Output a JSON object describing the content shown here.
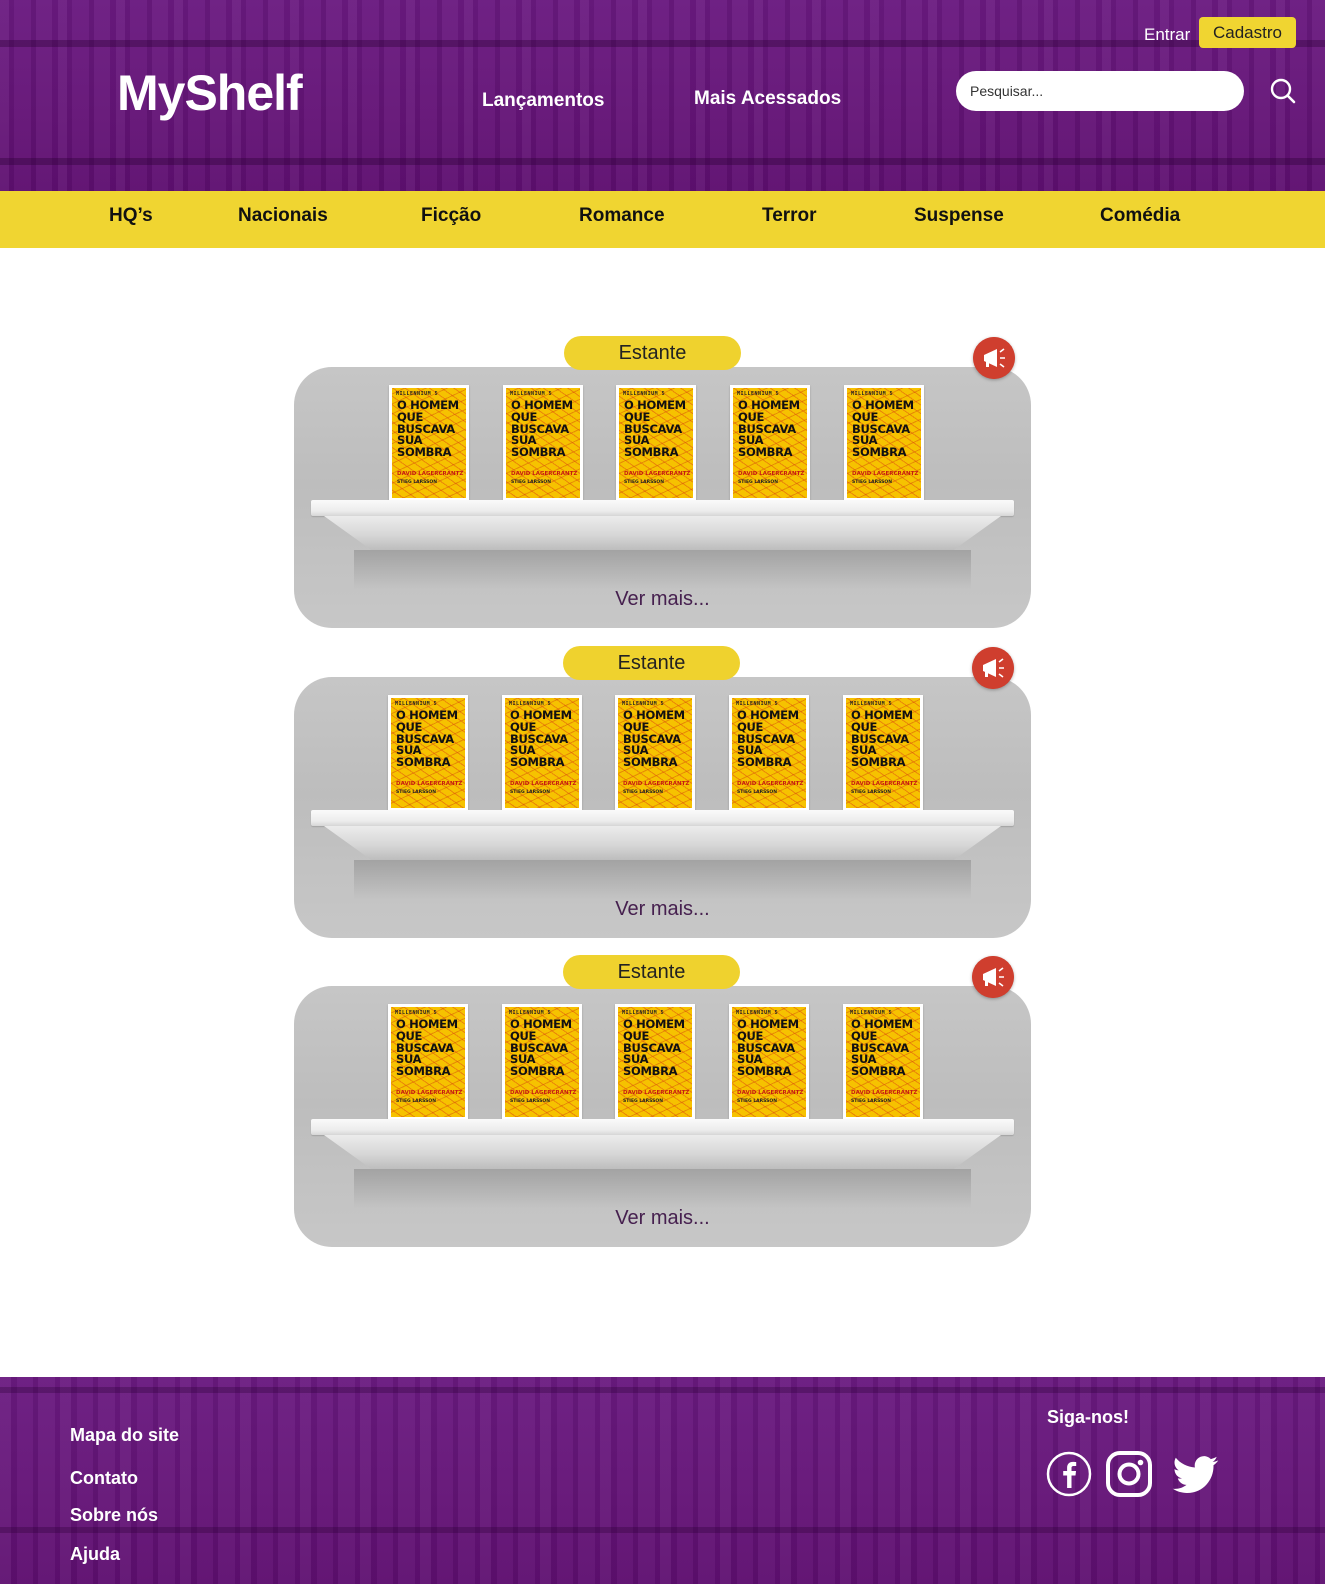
{
  "header": {
    "logo": "MyShelf",
    "nav": [
      "Lançamentos",
      "Mais Acessados"
    ],
    "login": "Entrar",
    "signup": "Cadastro",
    "search_placeholder": "Pesquisar...",
    "search_icon": "search-icon"
  },
  "categories": [
    "HQ’s",
    "Nacionais",
    "Ficção",
    "Romance",
    "Terror",
    "Suspense",
    "Comédia"
  ],
  "shelves": [
    {
      "label": "Estante",
      "see_more": "Ver mais...",
      "promo_icon": "megaphone-icon",
      "books": [
        {
          "series": "MILLENNIUM 5",
          "title": "O HOMEM QUE BUSCAVA SUA SOMBRA",
          "author": "DAVID LAGERCRANTZ",
          "creator": "STIEG LARSSON"
        },
        {
          "series": "MILLENNIUM 5",
          "title": "O HOMEM QUE BUSCAVA SUA SOMBRA",
          "author": "DAVID LAGERCRANTZ",
          "creator": "STIEG LARSSON"
        },
        {
          "series": "MILLENNIUM 5",
          "title": "O HOMEM QUE BUSCAVA SUA SOMBRA",
          "author": "DAVID LAGERCRANTZ",
          "creator": "STIEG LARSSON"
        },
        {
          "series": "MILLENNIUM 5",
          "title": "O HOMEM QUE BUSCAVA SUA SOMBRA",
          "author": "DAVID LAGERCRANTZ",
          "creator": "STIEG LARSSON"
        },
        {
          "series": "MILLENNIUM 5",
          "title": "O HOMEM QUE BUSCAVA SUA SOMBRA",
          "author": "DAVID LAGERCRANTZ",
          "creator": "STIEG LARSSON"
        }
      ]
    },
    {
      "label": "Estante",
      "see_more": "Ver mais...",
      "promo_icon": "megaphone-icon",
      "books": [
        {
          "series": "MILLENNIUM 5",
          "title": "O HOMEM QUE BUSCAVA SUA SOMBRA",
          "author": "DAVID LAGERCRANTZ",
          "creator": "STIEG LARSSON"
        },
        {
          "series": "MILLENNIUM 5",
          "title": "O HOMEM QUE BUSCAVA SUA SOMBRA",
          "author": "DAVID LAGERCRANTZ",
          "creator": "STIEG LARSSON"
        },
        {
          "series": "MILLENNIUM 5",
          "title": "O HOMEM QUE BUSCAVA SUA SOMBRA",
          "author": "DAVID LAGERCRANTZ",
          "creator": "STIEG LARSSON"
        },
        {
          "series": "MILLENNIUM 5",
          "title": "O HOMEM QUE BUSCAVA SUA SOMBRA",
          "author": "DAVID LAGERCRANTZ",
          "creator": "STIEG LARSSON"
        },
        {
          "series": "MILLENNIUM 5",
          "title": "O HOMEM QUE BUSCAVA SUA SOMBRA",
          "author": "DAVID LAGERCRANTZ",
          "creator": "STIEG LARSSON"
        }
      ]
    },
    {
      "label": "Estante",
      "see_more": "Ver mais...",
      "promo_icon": "megaphone-icon",
      "books": [
        {
          "series": "MILLENNIUM 5",
          "title": "O HOMEM QUE BUSCAVA SUA SOMBRA",
          "author": "DAVID LAGERCRANTZ",
          "creator": "STIEG LARSSON"
        },
        {
          "series": "MILLENNIUM 5",
          "title": "O HOMEM QUE BUSCAVA SUA SOMBRA",
          "author": "DAVID LAGERCRANTZ",
          "creator": "STIEG LARSSON"
        },
        {
          "series": "MILLENNIUM 5",
          "title": "O HOMEM QUE BUSCAVA SUA SOMBRA",
          "author": "DAVID LAGERCRANTZ",
          "creator": "STIEG LARSSON"
        },
        {
          "series": "MILLENNIUM 5",
          "title": "O HOMEM QUE BUSCAVA SUA SOMBRA",
          "author": "DAVID LAGERCRANTZ",
          "creator": "STIEG LARSSON"
        },
        {
          "series": "MILLENNIUM 5",
          "title": "O HOMEM QUE BUSCAVA SUA SOMBRA",
          "author": "DAVID LAGERCRANTZ",
          "creator": "STIEG LARSSON"
        }
      ]
    }
  ],
  "footer": {
    "links": [
      "Mapa do site",
      "Contato",
      "Sobre nós",
      "Ajuda"
    ],
    "follow": "Siga-nos!",
    "social": [
      "facebook-icon",
      "instagram-icon",
      "twitter-icon"
    ]
  },
  "colors": {
    "header_purple": "#641477",
    "accent_yellow": "#f0d531",
    "promo_red": "#cf3e2e",
    "see_more_text": "#46204f",
    "book_yellow": "#f6c200"
  }
}
